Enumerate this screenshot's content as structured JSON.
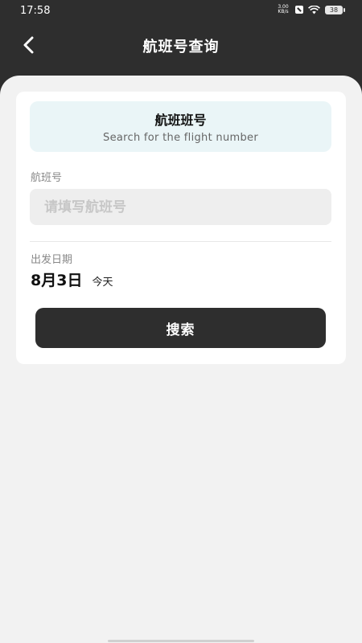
{
  "status_bar": {
    "time": "17:58",
    "net_speed_value": "3.00",
    "net_speed_unit": "KB/s",
    "battery": "38"
  },
  "header": {
    "title": "航班号查询",
    "back_icon": "chevron-left-icon"
  },
  "banner": {
    "title": "航班班号",
    "subtitle": "Search for the flight number"
  },
  "form": {
    "flight_label": "航班号",
    "flight_placeholder": "请填写航班号",
    "flight_value": "",
    "date_label": "出发日期",
    "date_value": "8月3日",
    "date_day": "今天"
  },
  "actions": {
    "search_label": "搜索"
  },
  "colors": {
    "header_bg": "#2e2e2e",
    "page_bg": "#f2f2f2",
    "banner_bg": "#eaf5f7",
    "button_bg": "#2e2e2e"
  }
}
